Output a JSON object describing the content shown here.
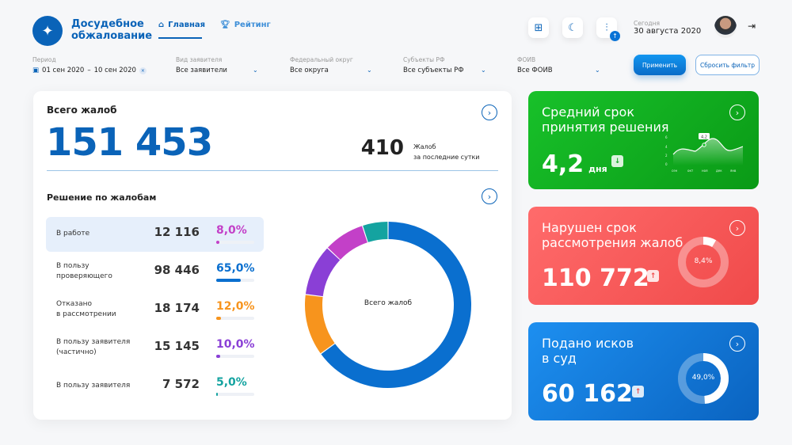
{
  "header": {
    "brand": "Досудебное обжалование",
    "logo_icon": "coat-of-arms-icon",
    "nav": [
      {
        "label": "Главная",
        "icon": "home-icon",
        "active": true
      },
      {
        "label": "Рейтинг",
        "icon": "trophy-icon"
      }
    ],
    "today_label": "Сегодня",
    "today_date": "30 августа 2020"
  },
  "filters": {
    "period": {
      "label": "Период",
      "from": "01 сен 2020",
      "to": "10 сен 2020"
    },
    "applicant": {
      "label": "Вид заявителя",
      "value": "Все заявители"
    },
    "district": {
      "label": "Федеральный округ",
      "value": "Все округа"
    },
    "subjects": {
      "label": "Субъекты РФ",
      "value": "Все субъекты РФ"
    },
    "foiv": {
      "label": "ФОИВ",
      "value": "Все ФОИВ"
    },
    "apply": "Применить",
    "reset": "Сбросить фильтр"
  },
  "total": {
    "title": "Всего жалоб",
    "value": "151 453",
    "day_value": "410",
    "day_label1": "Жалоб",
    "day_label2": "за последние сутки"
  },
  "decisions": {
    "title": "Решение по жалобам",
    "center_label": "Всего жалоб",
    "rows": [
      {
        "label1": "В работе",
        "label2": "",
        "value": "12 116",
        "pct": "8,0%",
        "fraction": 0.08,
        "color": "#c340c8"
      },
      {
        "label1": "В пользу",
        "label2": "проверяющего",
        "value": "98 446",
        "pct": "65,0%",
        "fraction": 0.65,
        "color": "#0a6fcf"
      },
      {
        "label1": "Отказано",
        "label2": "в рассмотрении",
        "value": "18 174",
        "pct": "12,0%",
        "fraction": 0.12,
        "color": "#f7941d"
      },
      {
        "label1": "В пользу заявителя",
        "label2": "(частично)",
        "value": "15 145",
        "pct": "10,0%",
        "fraction": 0.1,
        "color": "#8a3fd6"
      },
      {
        "label1": "В пользу заявителя",
        "label2": "",
        "value": "7 572",
        "pct": "5,0%",
        "fraction": 0.05,
        "color": "#14a3a0"
      }
    ]
  },
  "avg_term": {
    "title1": "Средний срок",
    "title2": "принятия решения",
    "value": "4,2",
    "unit": "дня",
    "trend": "down",
    "chart": {
      "y_ticks": [
        "6",
        "4",
        "2",
        "0"
      ],
      "x_ticks": [
        "сен",
        "окт",
        "ноя",
        "дек",
        "янв"
      ],
      "peak_label": "4,2"
    }
  },
  "violated": {
    "title1": "Нарушен срок",
    "title2": "рассмотрения жалоб",
    "value": "110 772",
    "pct": "8,4%",
    "fraction": 0.084,
    "trend": "up"
  },
  "lawsuits": {
    "title1": "Подано исков",
    "title2": "в суд",
    "value": "60 162",
    "pct": "49,0%",
    "fraction": 0.49,
    "trend": "up"
  }
}
